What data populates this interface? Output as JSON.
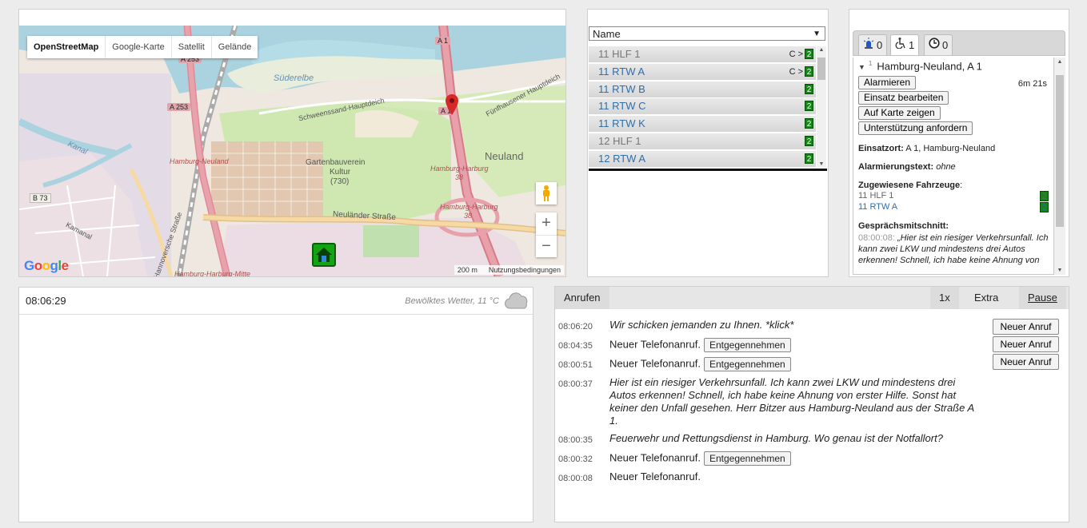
{
  "map": {
    "types": [
      "OpenStreetMap",
      "Google-Karte",
      "Satellit",
      "Gelände"
    ],
    "active_type": "OpenStreetMap",
    "labels": {
      "a1": "A 1",
      "a1b": "A 1",
      "a253a": "A 253",
      "a253b": "A 253",
      "b73": "B 73",
      "suederelbe": "Süderelbe",
      "neuland": "Neuland",
      "gartenbau": "Gartenbauverein",
      "kultur": "Kultur",
      "kultur_num": "(730)",
      "hh_harburg1": "Hamburg-Harburg",
      "num38a": "38",
      "hh_harburg2": "Hamburg-Harburg",
      "num38b": "38",
      "hh_neuland": "Hamburg-Neuland",
      "neulaender": "Neuländer Straße",
      "schweenssand": "Schweenssand-Hauptdeich",
      "fuenfhausen": "Fünfhausener Hauptdeich",
      "kamanal": "Kamanal",
      "hh_mitte": "Hamburg-Harburg-Mitte",
      "hannoversche": "Hannoversche Straße",
      "kanal": "Kanal"
    },
    "zoom_in": "+",
    "zoom_out": "−",
    "scale": "200 m",
    "terms": "Nutzungsbedingungen",
    "logo": "Google",
    "icons": {
      "pegman": "pegman-icon",
      "pin": "map-pin-icon",
      "station": "house-icon"
    }
  },
  "vehicles": {
    "sort_label": "Name",
    "rows": [
      {
        "name": "11 HLF 1",
        "status": "C >",
        "badge": "2",
        "style": "gray"
      },
      {
        "name": "11 RTW A",
        "status": "C >",
        "badge": "2",
        "style": "blue"
      },
      {
        "name": "11 RTW B",
        "status": "",
        "badge": "2",
        "style": "blue"
      },
      {
        "name": "11 RTW C",
        "status": "",
        "badge": "2",
        "style": "blue"
      },
      {
        "name": "11 RTW K",
        "status": "",
        "badge": "2",
        "style": "blue"
      },
      {
        "name": "12 HLF 1",
        "status": "",
        "badge": "2",
        "style": "gray"
      },
      {
        "name": "12 RTW A",
        "status": "",
        "badge": "2",
        "style": "blue"
      }
    ]
  },
  "incident": {
    "tabs": [
      {
        "icon": "siren-icon",
        "count": "0"
      },
      {
        "icon": "wheelchair-icon",
        "count": "1"
      },
      {
        "icon": "clock-icon",
        "count": "0"
      }
    ],
    "index": "1",
    "title": "Hamburg-Neuland, A 1",
    "timer": "6m 21s",
    "buttons": {
      "alarm": "Alarmieren",
      "edit": "Einsatz bearbeiten",
      "show_map": "Auf Karte zeigen",
      "support": "Unterstützung anfordern"
    },
    "location_label": "Einsatzort:",
    "location": "A 1, Hamburg-Neuland",
    "alarm_text_label": "Alarmierungstext:",
    "alarm_text": "ohne",
    "assigned_label": "Zugewiesene Fahrzeuge",
    "assigned": [
      {
        "name": "11 HLF 1",
        "badge": "2",
        "style": "gray"
      },
      {
        "name": "11 RTW A",
        "badge": "2",
        "style": "blue"
      }
    ],
    "transcript_label": "Gesprächsmitschnitt:",
    "transcript_time": "08:00:08:",
    "transcript_text": "„Hier ist ein riesiger Verkehrsunfall. Ich kann zwei LKW und mindestens drei Autos erkennen! Schnell, ich habe keine Ahnung von"
  },
  "status": {
    "clock": "08:06:29",
    "weather": "Bewölktes Wetter, 11 °C",
    "weather_icon": "cloud-icon"
  },
  "calls": {
    "tab_label": "Anrufen",
    "speed": "1x",
    "extra": "Extra",
    "pause": "Pause",
    "new_call_label": "Neuer Anruf",
    "accept_label": "Entgegennehmen",
    "log": [
      {
        "time": "08:06:20",
        "text": "Wir schicken jemanden zu Ihnen. *klick*",
        "italic": true,
        "button": false
      },
      {
        "time": "08:04:35",
        "text": "Neuer Telefonanruf.",
        "italic": false,
        "button": true
      },
      {
        "time": "08:00:51",
        "text": "Neuer Telefonanruf.",
        "italic": false,
        "button": true
      },
      {
        "time": "08:00:37",
        "text": "Hier ist ein riesiger Verkehrsunfall. Ich kann zwei LKW und mindestens drei Autos erkennen! Schnell, ich habe keine Ahnung von erster Hilfe. Sonst hat keiner den Unfall gesehen. Herr Bitzer aus Hamburg-Neuland aus der Straße A 1.",
        "italic": true,
        "button": false
      },
      {
        "time": "08:00:35",
        "text": "Feuerwehr und Rettungsdienst in Hamburg. Wo genau ist der Notfallort?",
        "italic": true,
        "button": false
      },
      {
        "time": "08:00:32",
        "text": "Neuer Telefonanruf.",
        "italic": false,
        "button": true
      },
      {
        "time": "08:00:08",
        "text": "Neuer Telefonanruf.",
        "italic": false,
        "button": false
      }
    ],
    "new_call_buttons": 3
  }
}
